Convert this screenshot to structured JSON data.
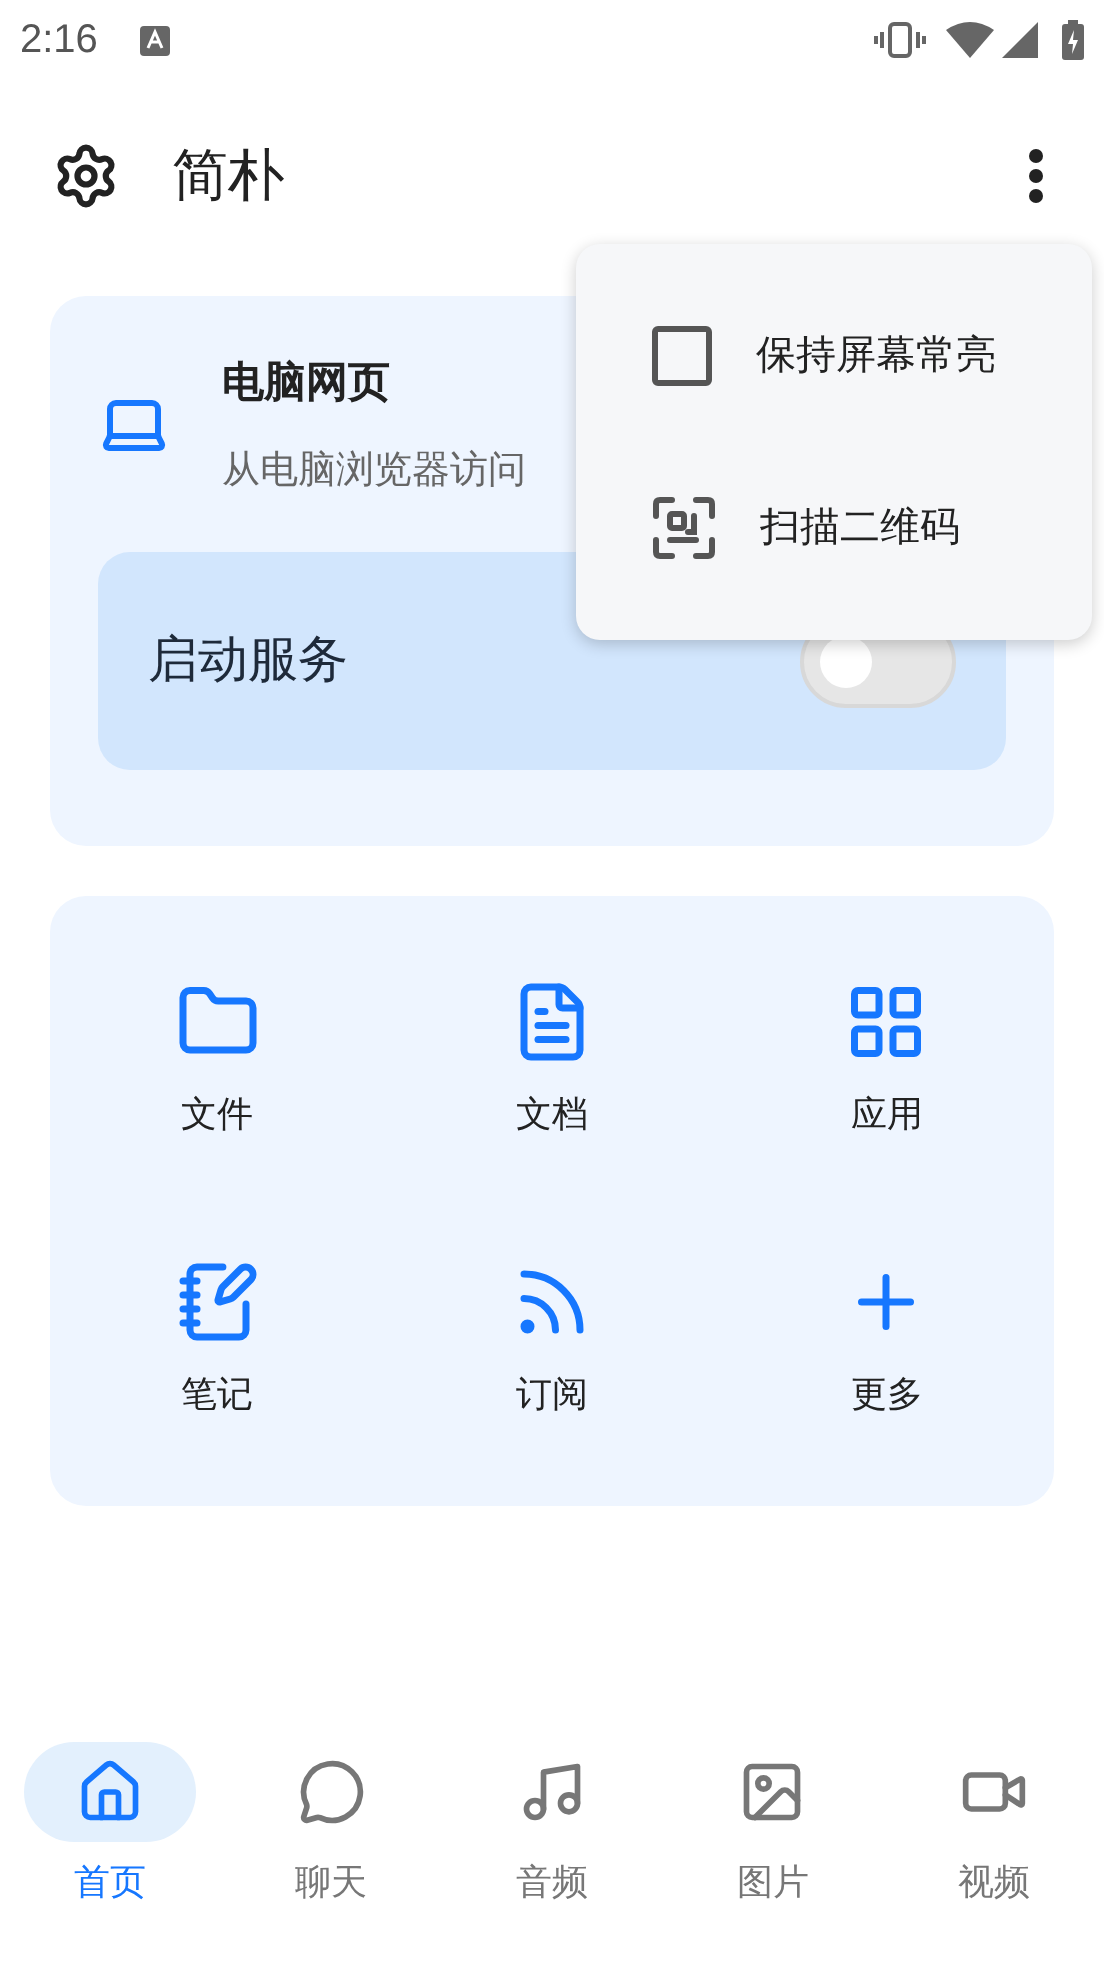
{
  "status_bar": {
    "time": "2:16"
  },
  "app_bar": {
    "title": "简朴"
  },
  "web_card": {
    "title": "电脑网页",
    "subtitle": "从电脑浏览器访问",
    "service": {
      "label": "启动服务",
      "on": false
    }
  },
  "shortcuts": [
    {
      "kind": "folder",
      "label": "文件"
    },
    {
      "kind": "document",
      "label": "文档"
    },
    {
      "kind": "apps",
      "label": "应用"
    },
    {
      "kind": "notes",
      "label": "笔记"
    },
    {
      "kind": "rss",
      "label": "订阅"
    },
    {
      "kind": "plus",
      "label": "更多"
    }
  ],
  "menu": [
    {
      "kind": "checkbox",
      "label": "保持屏幕常亮",
      "checked": false
    },
    {
      "kind": "scan",
      "label": "扫描二维码"
    }
  ],
  "bottom_nav": [
    {
      "kind": "home",
      "label": "首页",
      "selected": true
    },
    {
      "kind": "chat",
      "label": "聊天",
      "selected": false
    },
    {
      "kind": "music",
      "label": "音频",
      "selected": false
    },
    {
      "kind": "image",
      "label": "图片",
      "selected": false
    },
    {
      "kind": "video",
      "label": "视频",
      "selected": false
    }
  ]
}
